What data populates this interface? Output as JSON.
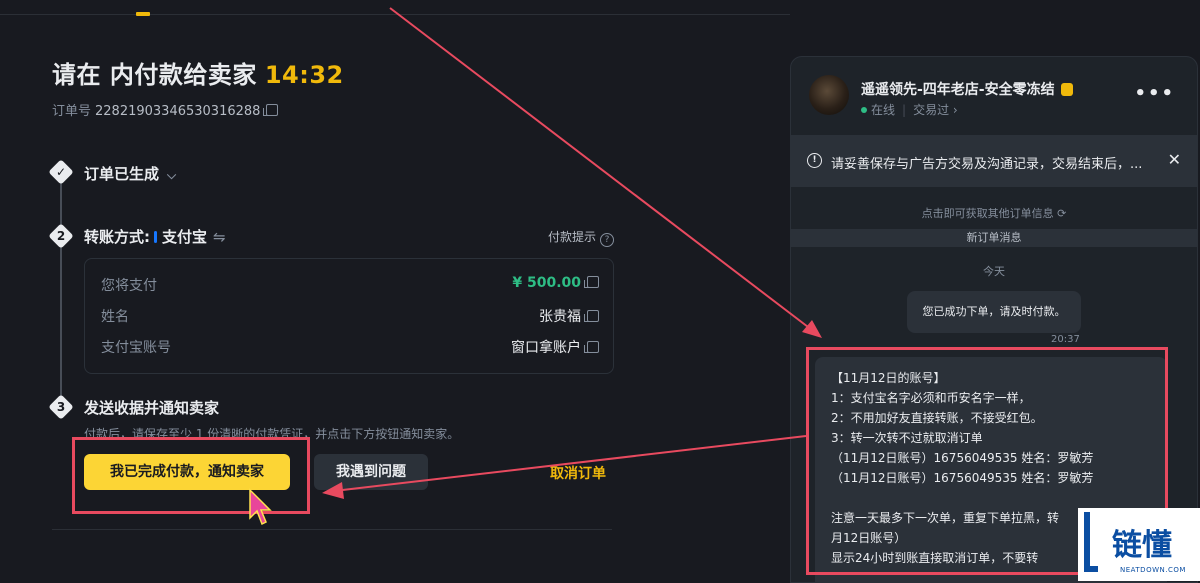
{
  "header": {
    "title": "请在 内付款给卖家",
    "timer": "14:32",
    "order_label": "订单号",
    "order_number": "22821903346530316288"
  },
  "steps": {
    "step1": {
      "label": "订单已生成"
    },
    "step2": {
      "number": "2",
      "label": "转账方式:",
      "method": "支付宝",
      "hint": "付款提示",
      "rows": [
        {
          "key": "您将支付",
          "value": "¥ 500.00"
        },
        {
          "key": "姓名",
          "value": "张贵福"
        },
        {
          "key": "支付宝账号",
          "value": "窗口拿账户"
        }
      ]
    },
    "step3": {
      "number": "3",
      "label": "发送收据并通知卖家",
      "hint": "付款后，请保存至少 1 份清晰的付款凭证，并点击下方按钮通知卖家。"
    }
  },
  "actions": {
    "confirm_label": "我已完成付款，通知卖家",
    "problem_label": "我遇到问题",
    "cancel_label": "取消订单"
  },
  "chat": {
    "seller_name": "遥遥领先-四年老店-安全零冻结",
    "status": "在线",
    "trades_label": "交易过",
    "notice": "请妥善保存与广告方交易及沟通记录，交易结束后，...",
    "get_info": "点击即可获取其他订单信息",
    "new_msg": "新订单消息",
    "today": "今天",
    "msg1": "您已成功下单，请及时付款。",
    "msg1_time": "20:37",
    "msg2_lines": [
      "【11月12日的账号】",
      "1：支付宝名字必须和币安名字一样，",
      "2：不用加好友直接转账，不接受红包。",
      "3：转一次转不过就取消订单",
      "（11月12日账号）16756049535 姓名：罗敏芳",
      "（11月12日账号）16756049535 姓名：罗敏芳",
      "",
      " 注意一天最多下一次单，重复下单拉黑，转",
      "月12日账号）",
      " 显示24小时到账直接取消订单，不要转"
    ]
  },
  "watermark": {
    "text": "链懂",
    "sub": "NEATDOWN.COM"
  },
  "colors": {
    "accent": "#f0b90b",
    "button": "#fcd535",
    "green": "#2ebd85",
    "annotation": "#e84a5f"
  }
}
